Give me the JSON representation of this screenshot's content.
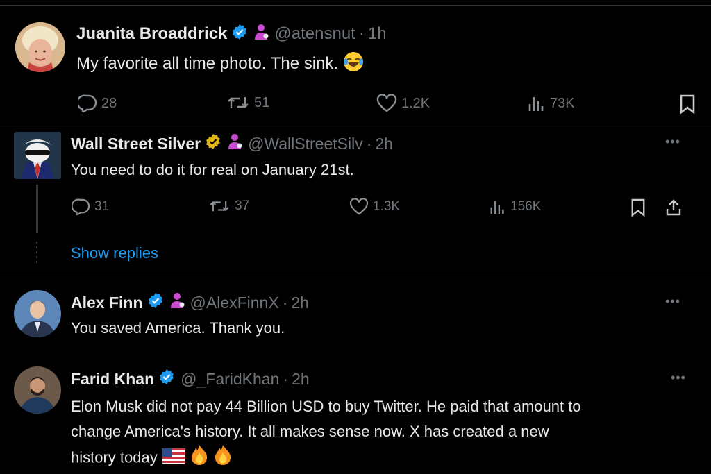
{
  "tweets": [
    {
      "name": "Juanita Broaddrick",
      "handle": "@atensnut",
      "time": "1h",
      "text": "My favorite all time photo.  The sink.",
      "replies": "28",
      "reposts": "51",
      "likes": "1.2K",
      "views": "73K"
    },
    {
      "name": "Wall Street Silver",
      "handle": "@WallStreetSilv",
      "time": "2h",
      "text": "You need to do it for real on January 21st.",
      "replies": "31",
      "reposts": "37",
      "likes": "1.3K",
      "views": "156K"
    },
    {
      "name": "Alex Finn",
      "handle": "@AlexFinnX",
      "time": "2h",
      "text": "You saved America. Thank you."
    },
    {
      "name": "Farid Khan",
      "handle": "@_FaridKhan",
      "time": "2h",
      "text_lines": [
        "Elon Musk did not pay 44 Billion USD to buy Twitter. He paid that amount to",
        "change America's history. It all makes sense now. X has created a new",
        "history today"
      ]
    }
  ],
  "show_replies_label": "Show replies",
  "colors": {
    "background": "#000000",
    "text": "#e7e9ea",
    "muted": "#71767b",
    "accent": "#1d9bf0",
    "gold": "#e2b719",
    "affiliate": "#c94bd0"
  },
  "icons": [
    "reply-icon",
    "repost-icon",
    "like-icon",
    "views-icon",
    "bookmark-icon",
    "share-icon",
    "verified-icon",
    "affiliate-icon",
    "more-icon"
  ]
}
